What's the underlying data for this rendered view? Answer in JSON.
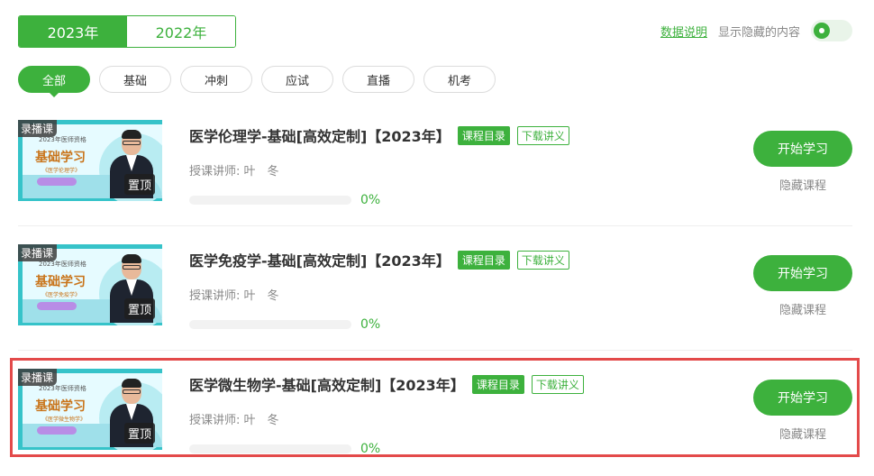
{
  "year_tabs": [
    {
      "label": "2023年",
      "active": true
    },
    {
      "label": "2022年",
      "active": false
    }
  ],
  "top_right": {
    "data_link": "数据说明",
    "show_hidden_label": "显示隐藏的内容",
    "toggle_on": true
  },
  "filters": [
    {
      "label": "全部",
      "active": true
    },
    {
      "label": "基础",
      "active": false
    },
    {
      "label": "冲刺",
      "active": false
    },
    {
      "label": "应试",
      "active": false
    },
    {
      "label": "直播",
      "active": false
    },
    {
      "label": "机考",
      "active": false
    }
  ],
  "courses": [
    {
      "thumb": {
        "badge": "录播课",
        "top_text": "2023年医师资格",
        "title": "基础学习",
        "sub": "《医学伦理学》",
        "pin": "置顶"
      },
      "title": "医学伦理学-基础[高效定制]【2023年】",
      "catalog_tag": "课程目录",
      "download_tag": "下载讲义",
      "teacher": "授课讲师:   叶　冬",
      "progress": 0,
      "progress_text": "0%",
      "start_label": "开始学习",
      "hide_label": "隐藏课程"
    },
    {
      "thumb": {
        "badge": "录播课",
        "top_text": "2023年医师资格",
        "title": "基础学习",
        "sub": "《医学免疫学》",
        "pin": "置顶"
      },
      "title": "医学免疫学-基础[高效定制]【2023年】",
      "catalog_tag": "课程目录",
      "download_tag": "下载讲义",
      "teacher": "授课讲师:   叶　冬",
      "progress": 0,
      "progress_text": "0%",
      "start_label": "开始学习",
      "hide_label": "隐藏课程"
    },
    {
      "thumb": {
        "badge": "录播课",
        "top_text": "2023年医师资格",
        "title": "基础学习",
        "sub": "《医学微生物学》",
        "pin": "置顶"
      },
      "title": "医学微生物学-基础[高效定制]【2023年】",
      "catalog_tag": "课程目录",
      "download_tag": "下载讲义",
      "teacher": "授课讲师:   叶　冬",
      "progress": 0,
      "progress_text": "0%",
      "start_label": "开始学习",
      "hide_label": "隐藏课程"
    }
  ],
  "colors": {
    "accent": "#3db13d",
    "highlight": "#e34a4a"
  }
}
